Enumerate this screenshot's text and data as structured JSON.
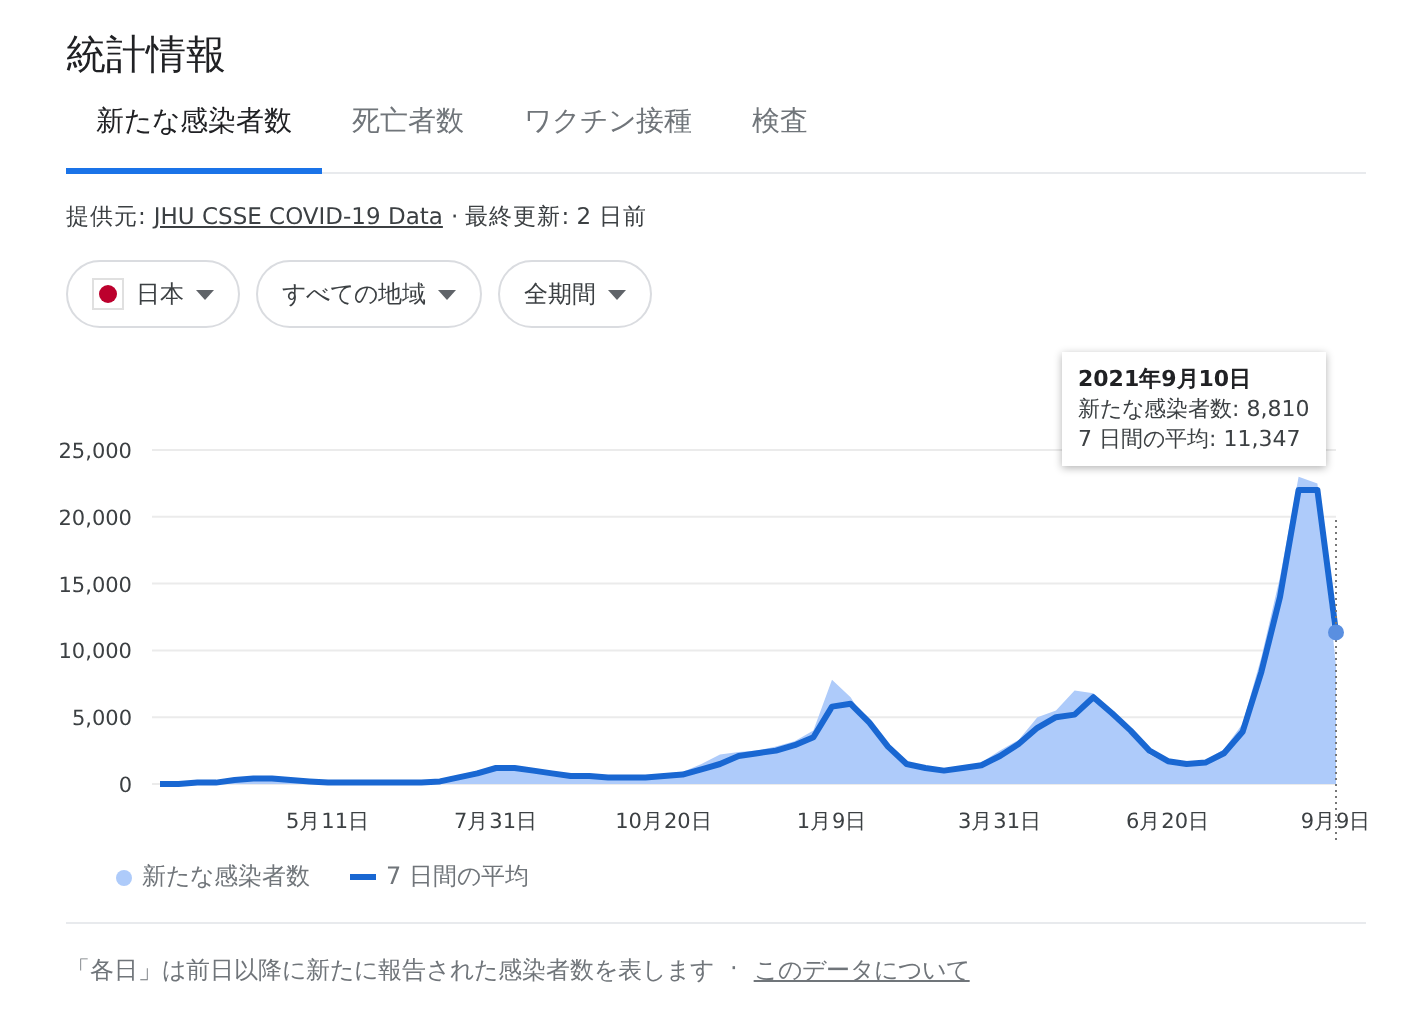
{
  "title": "統計情報",
  "tabs": [
    {
      "label": "新たな感染者数",
      "selected": true
    },
    {
      "label": "死亡者数",
      "selected": false
    },
    {
      "label": "ワクチン接種",
      "selected": false
    },
    {
      "label": "検査",
      "selected": false
    }
  ],
  "source": {
    "prefix": "提供元:",
    "link": "JHU CSSE COVID-19 Data",
    "suffix": "· 最終更新: 2 日前"
  },
  "filters": [
    {
      "kind": "country",
      "label": "日本"
    },
    {
      "kind": "plain",
      "label": "すべての地域"
    },
    {
      "kind": "plain",
      "label": "全期間"
    }
  ],
  "chart": {
    "chart_data": {
      "type": "area",
      "categories": [
        null,
        null,
        null,
        null,
        null,
        null,
        null,
        null,
        null,
        "5月11日",
        null,
        null,
        null,
        null,
        null,
        null,
        null,
        null,
        "7月31日",
        null,
        null,
        null,
        null,
        null,
        null,
        null,
        null,
        "10月20日",
        null,
        null,
        null,
        null,
        null,
        null,
        null,
        null,
        "1月9日",
        null,
        null,
        null,
        null,
        null,
        null,
        null,
        null,
        "3月31日",
        null,
        null,
        null,
        null,
        null,
        null,
        null,
        null,
        "6月20日",
        null,
        null,
        null,
        null,
        null,
        null,
        null,
        null,
        "9月9日"
      ],
      "series": [
        {
          "name": "新たな感染者数",
          "type": "area",
          "color": "#aecbfa",
          "values": [
            0,
            0,
            100,
            200,
            400,
            600,
            400,
            300,
            200,
            100,
            100,
            100,
            100,
            100,
            200,
            300,
            600,
            1000,
            1300,
            1200,
            900,
            700,
            600,
            600,
            500,
            600,
            600,
            800,
            900,
            1500,
            2200,
            2400,
            2500,
            2800,
            3200,
            4000,
            7800,
            6500,
            4300,
            2500,
            1400,
            1100,
            1000,
            1300,
            1600,
            2500,
            3300,
            5000,
            5500,
            7000,
            6800,
            5000,
            3700,
            2200,
            1500,
            1500,
            1800,
            2600,
            4500,
            9500,
            15500,
            23000,
            22500,
            8810
          ]
        },
        {
          "name": "7 日間の平均",
          "type": "line",
          "color": "#1967d2",
          "values": [
            0,
            0,
            100,
            100,
            300,
            400,
            400,
            300,
            200,
            100,
            100,
            100,
            100,
            100,
            100,
            200,
            500,
            800,
            1200,
            1200,
            1000,
            800,
            600,
            600,
            500,
            500,
            500,
            600,
            700,
            1100,
            1500,
            2100,
            2300,
            2500,
            2900,
            3500,
            5800,
            6000,
            4600,
            2800,
            1500,
            1200,
            1000,
            1200,
            1400,
            2100,
            3000,
            4200,
            5000,
            5200,
            6500,
            5300,
            4000,
            2500,
            1700,
            1500,
            1600,
            2300,
            3900,
            8400,
            14000,
            22000,
            22000,
            11347
          ]
        }
      ],
      "yticks": [
        {
          "value": 0,
          "label": "0"
        },
        {
          "value": 5000,
          "label": "5,000"
        },
        {
          "value": 10000,
          "label": "10,000"
        },
        {
          "value": 15000,
          "label": "15,000"
        },
        {
          "value": 20000,
          "label": "20,000"
        },
        {
          "value": 25000,
          "label": "25,000"
        }
      ],
      "ylim": [
        0,
        25000
      ],
      "grid": true
    },
    "tooltip": {
      "title": "2021年9月10日",
      "lines": [
        "新たな感染者数: 8,810",
        "7 日間の平均: 11,347"
      ]
    }
  },
  "footer": {
    "text": "「各日」は前日以降に新たに報告された感染者数を表します",
    "separator": "·",
    "link": "このデータについて"
  }
}
